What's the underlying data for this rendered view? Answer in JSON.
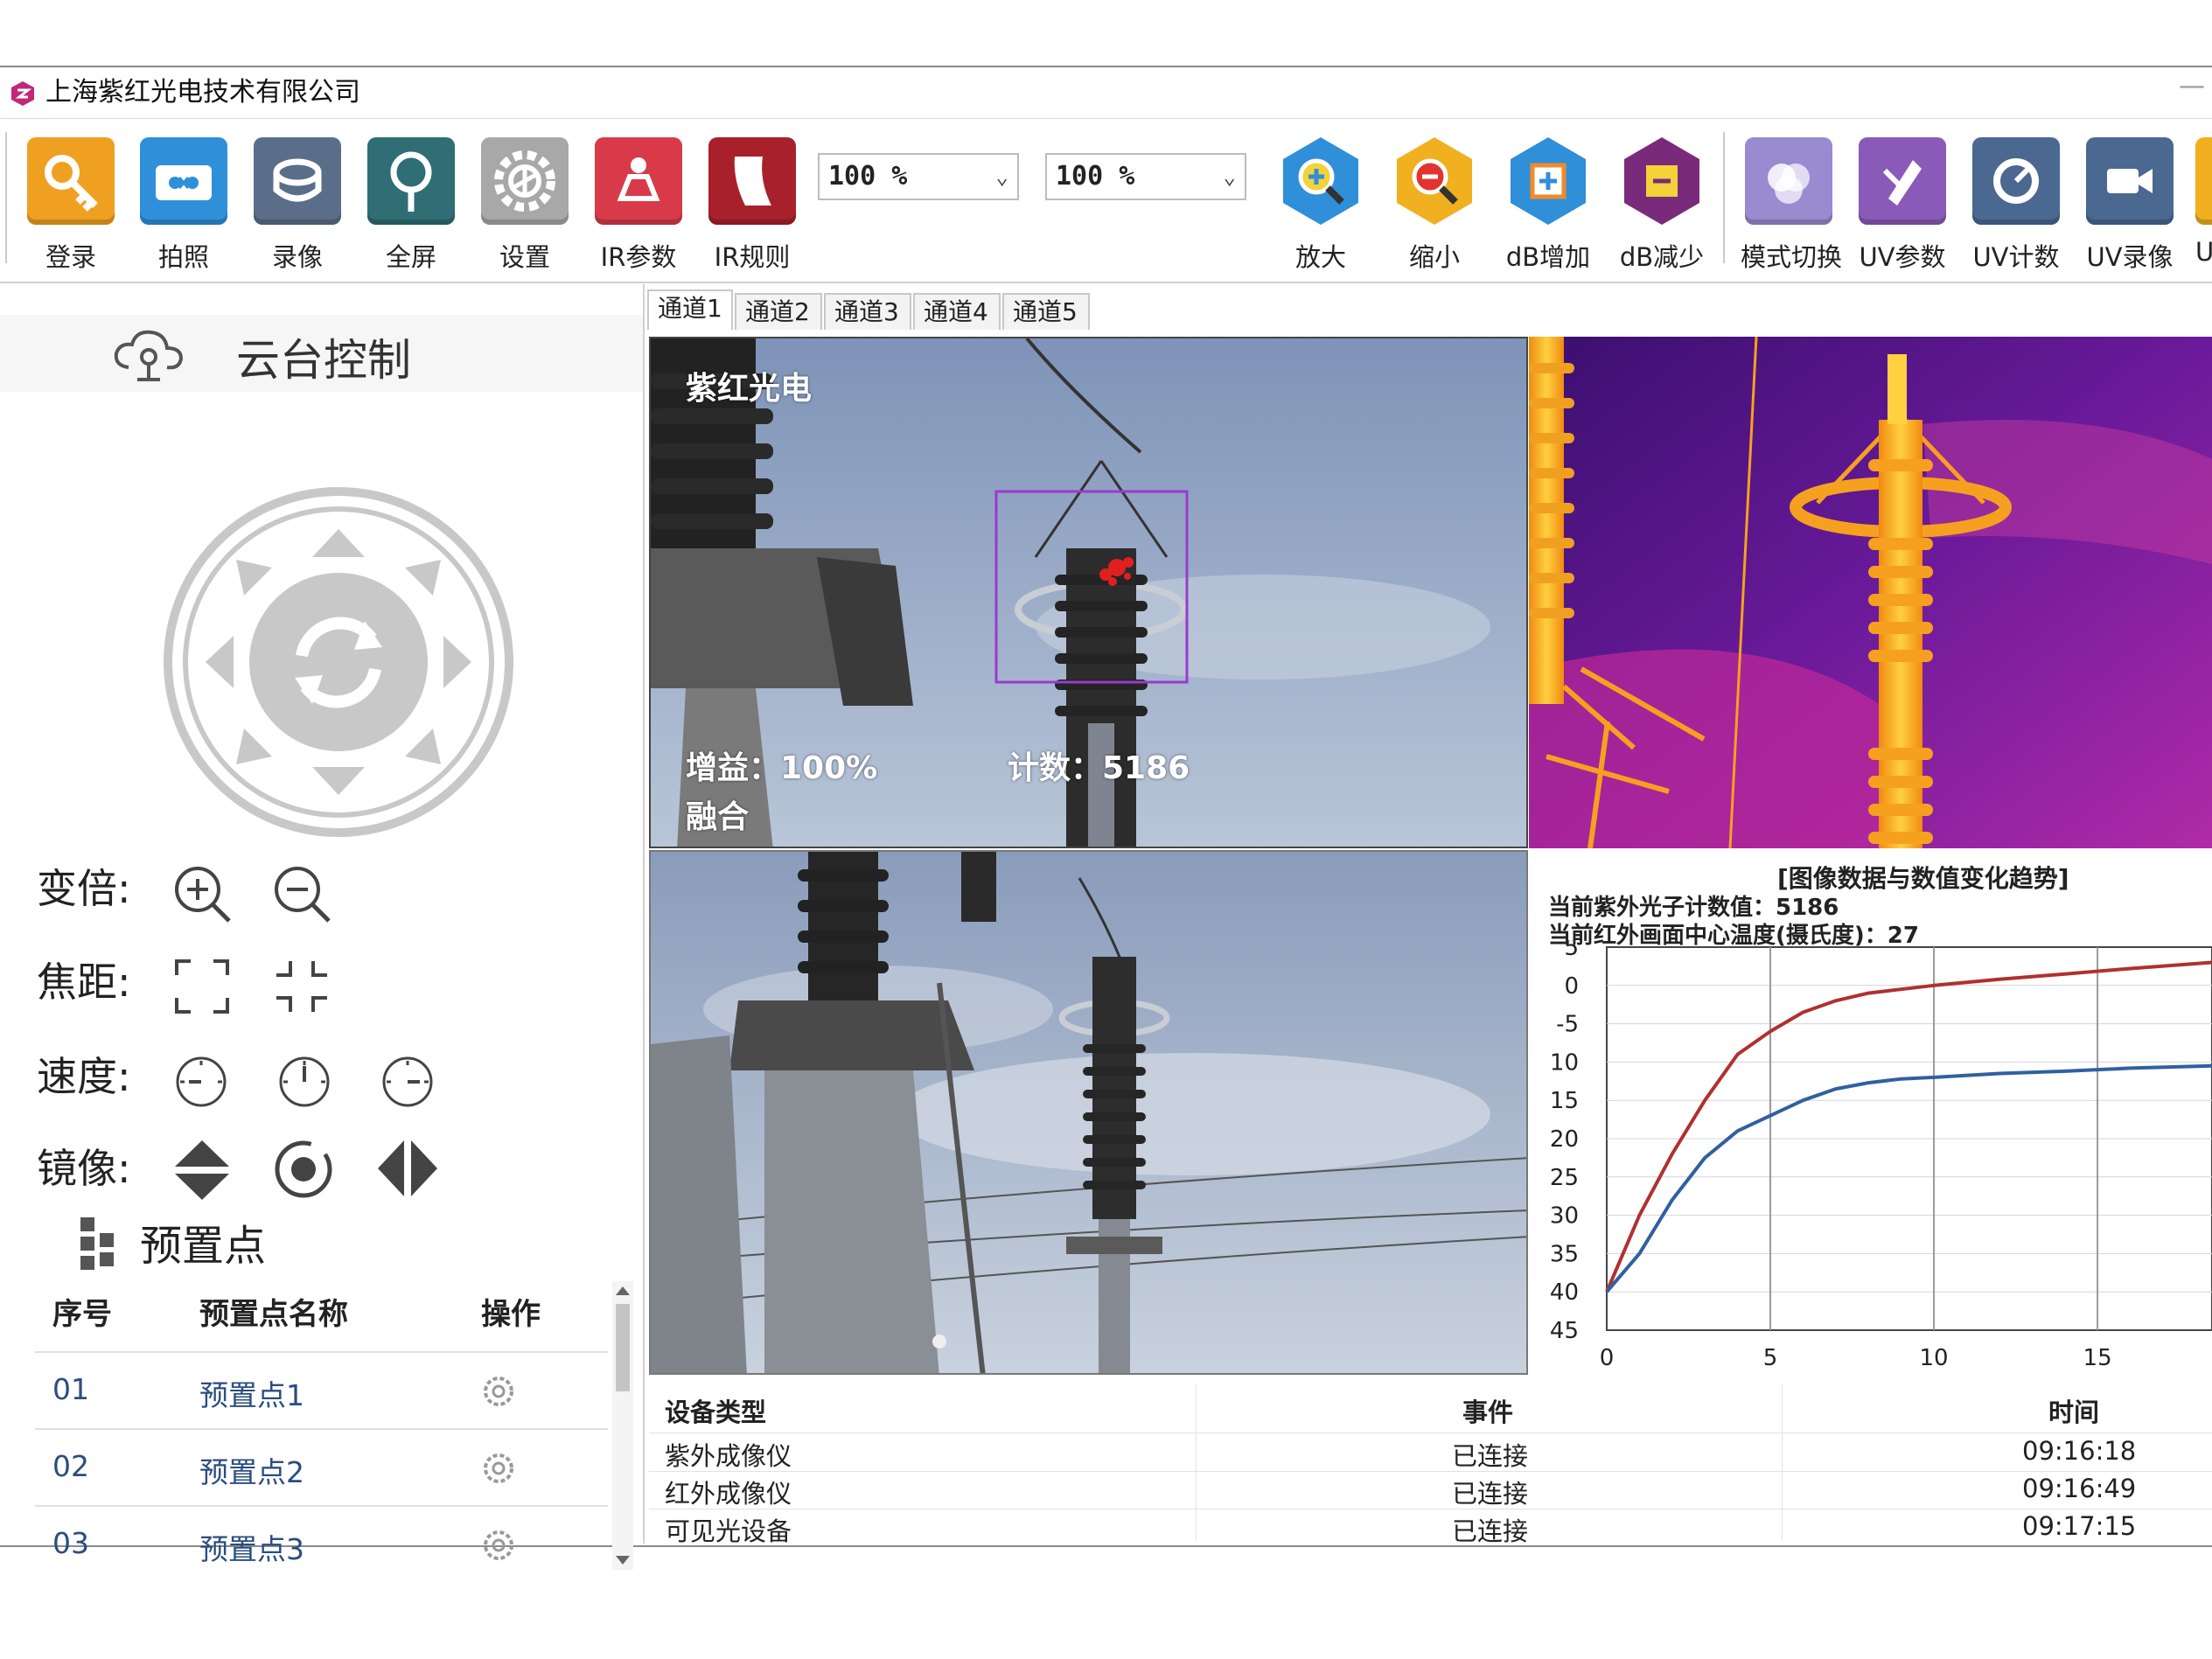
{
  "app": {
    "title": "上海紫红光电技术有限公司"
  },
  "toolbar": {
    "buttons": [
      {
        "label": "登录",
        "icon": "key-icon",
        "color": "#f0a020"
      },
      {
        "label": "拍照",
        "icon": "camera-icon",
        "color": "#2f8fd9"
      },
      {
        "label": "录像",
        "icon": "record-icon",
        "color": "#5a6e8a"
      },
      {
        "label": "全屏",
        "icon": "fullscreen-icon",
        "color": "#2e6e74"
      },
      {
        "label": "设置",
        "icon": "gear-icon",
        "color": "#a8a8a8"
      },
      {
        "label": "IR参数",
        "icon": "ir-params-icon",
        "color": "#d83a4a"
      },
      {
        "label": "IR规则",
        "icon": "ir-rules-icon",
        "color": "#a8202a"
      }
    ],
    "zoom_combo_1": "100 %",
    "zoom_combo_2": "100 %",
    "hex_buttons": [
      {
        "label": "放大",
        "icon": "zoom-in-icon",
        "color": "#2f8fd9"
      },
      {
        "label": "缩小",
        "icon": "zoom-out-icon",
        "color": "#f0b020"
      },
      {
        "label": "dB增加",
        "icon": "db-increase-icon",
        "color": "#2f8fd9"
      },
      {
        "label": "dB减少",
        "icon": "db-decrease-icon",
        "color": "#7a2a7a"
      }
    ],
    "uv_buttons": [
      {
        "label": "模式切换",
        "icon": "mode-switch-icon",
        "color": "#9a8ad0"
      },
      {
        "label": "UV参数",
        "icon": "uv-params-icon",
        "color": "#8a5ab8"
      },
      {
        "label": "UV计数",
        "icon": "uv-count-icon",
        "color": "#4a6890"
      },
      {
        "label": "UV录像",
        "icon": "uv-record-icon",
        "color": "#4a6890"
      },
      {
        "label": "U",
        "icon": "more-icon",
        "color": "#f0b020"
      }
    ]
  },
  "ptz": {
    "title": "云台控制",
    "zoom_label": "变倍:",
    "focus_label": "焦距:",
    "speed_label": "速度:",
    "mirror_label": "镜像:"
  },
  "presets": {
    "title": "预置点",
    "headers": [
      "序号",
      "预置点名称",
      "操作"
    ],
    "rows": [
      {
        "no": "01",
        "name": "预置点1"
      },
      {
        "no": "02",
        "name": "预置点2"
      },
      {
        "no": "03",
        "name": "预置点3"
      }
    ]
  },
  "tabs": [
    "通道1",
    "通道2",
    "通道3",
    "通道4",
    "通道5"
  ],
  "video": {
    "brand": "紫红光电",
    "gain": "增益：100%",
    "count": "计数：5186",
    "mode": "融合"
  },
  "chart_panel": {
    "title": "[图像数据与数值变化趋势]",
    "uv_count": "当前紫外光子计数值：5186",
    "ir_temp": "当前红外画面中心温度(摄氏度)：27"
  },
  "chart_data": {
    "type": "line",
    "y_ticks": [
      "5",
      "0",
      "-5",
      "10",
      "15",
      "20",
      "25",
      "30",
      "35",
      "40",
      "45"
    ],
    "x_ticks": [
      "0",
      "5",
      "10",
      "15"
    ],
    "xlim": [
      0,
      18.5
    ],
    "ylim": [
      5,
      -45
    ],
    "grid": true,
    "series": [
      {
        "color": "#b03030",
        "x": [
          0,
          1,
          2,
          3,
          4,
          5,
          6,
          7,
          8,
          9,
          10,
          12,
          14,
          16,
          18.5
        ],
        "y": [
          -40,
          -30,
          -22,
          -15,
          -9,
          -6,
          -3.5,
          -2,
          -1,
          -0.5,
          0,
          0.8,
          1.5,
          2.2,
          3
        ]
      },
      {
        "color": "#3060a0",
        "x": [
          0,
          1,
          2,
          3,
          4,
          5,
          6,
          7,
          8,
          9,
          10,
          12,
          14,
          16,
          18.5
        ],
        "y": [
          -40,
          -35,
          -28,
          -22.5,
          -19,
          -17,
          -15,
          -13.5,
          -12.7,
          -12.2,
          -12,
          -11.5,
          -11.2,
          -10.8,
          -10.5
        ]
      }
    ]
  },
  "events": {
    "headers": [
      "设备类型",
      "事件",
      "时间"
    ],
    "rows": [
      {
        "type": "紫外成像仪",
        "event": "已连接",
        "time": "09:16:18"
      },
      {
        "type": "红外成像仪",
        "event": "已连接",
        "time": "09:16:49"
      },
      {
        "type": "可见光设备",
        "event": "已连接",
        "time": "09:17:15"
      }
    ]
  }
}
